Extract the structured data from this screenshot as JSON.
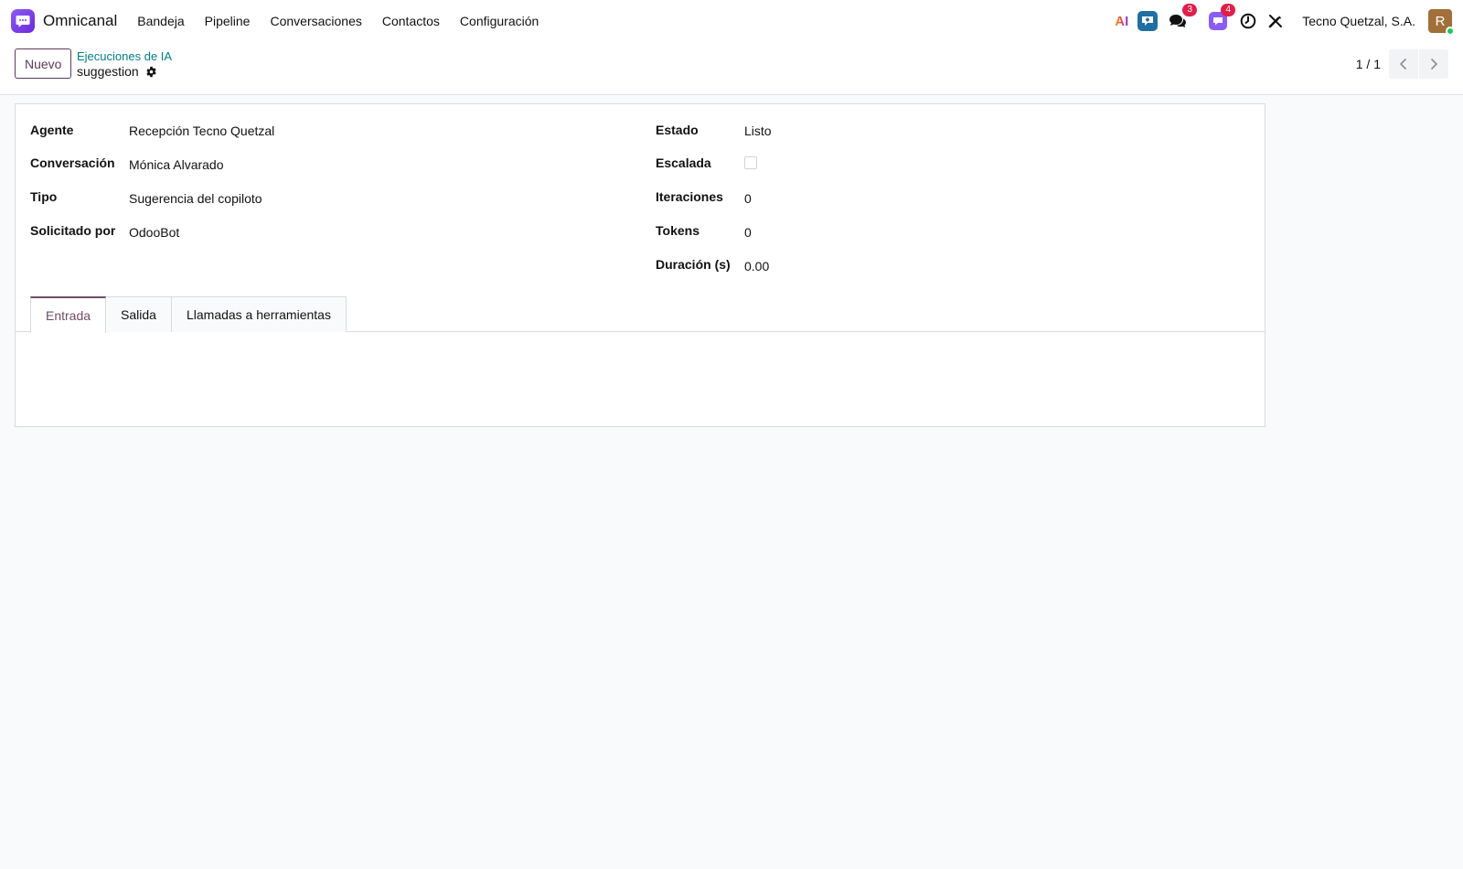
{
  "app": {
    "name": "Omnicanal",
    "menu": [
      "Bandeja",
      "Pipeline",
      "Conversaciones",
      "Contactos",
      "Configuración"
    ]
  },
  "systray": {
    "ai_label": "AI",
    "chat_badge": "3",
    "activity_badge": "4",
    "company": "Tecno Quetzal, S.A.",
    "avatar_initial": "R"
  },
  "control_panel": {
    "new_button": "Nuevo",
    "breadcrumb": "Ejecuciones de IA",
    "record_name": "suggestion",
    "pager": "1 / 1"
  },
  "form": {
    "left_fields": [
      {
        "label": "Agente",
        "value": "Recepción Tecno Quetzal"
      },
      {
        "label": "Conversación",
        "value": "Mónica Alvarado"
      },
      {
        "label": "Tipo",
        "value": "Sugerencia del copiloto"
      },
      {
        "label": "Solicitado por",
        "value": "OdooBot"
      }
    ],
    "right_fields": [
      {
        "label": "Estado",
        "value": "Listo"
      },
      {
        "label": "Escalada",
        "checked": false
      },
      {
        "label": "Iteraciones",
        "value": "0"
      },
      {
        "label": "Tokens",
        "value": "0"
      },
      {
        "label": "Duración (s)",
        "value": "0.00"
      }
    ],
    "tabs": [
      {
        "label": "Entrada",
        "active": true
      },
      {
        "label": "Salida",
        "active": false
      },
      {
        "label": "Llamadas a herramientas",
        "active": false
      }
    ]
  },
  "colors": {
    "brand": "#714b67",
    "link": "#017e84",
    "badge": "#e11d48",
    "logo": "#7c3aed"
  }
}
